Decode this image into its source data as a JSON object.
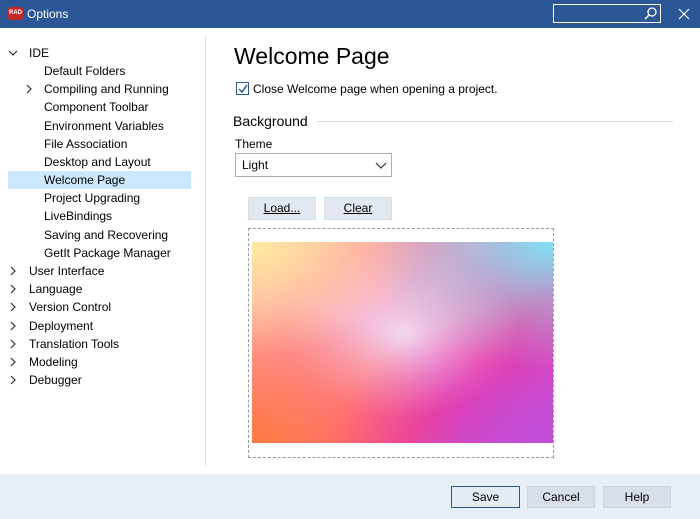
{
  "window": {
    "app_icon_text": "RAD",
    "title": "Options",
    "search_placeholder": ""
  },
  "tree": [
    {
      "label": "IDE",
      "expanded": true
    },
    {
      "label": "Default Folders"
    },
    {
      "label": "Compiling and Running",
      "expandable": true
    },
    {
      "label": "Component Toolbar"
    },
    {
      "label": "Environment Variables"
    },
    {
      "label": "File Association"
    },
    {
      "label": "Desktop and Layout"
    },
    {
      "label": "Welcome Page",
      "selected": true
    },
    {
      "label": "Project Upgrading"
    },
    {
      "label": "LiveBindings"
    },
    {
      "label": "Saving and Recovering"
    },
    {
      "label": "GetIt Package Manager"
    },
    {
      "label": "User Interface",
      "expandable": true
    },
    {
      "label": "Language",
      "expandable": true
    },
    {
      "label": "Version Control",
      "expandable": true
    },
    {
      "label": "Deployment",
      "expandable": true
    },
    {
      "label": "Translation Tools",
      "expandable": true
    },
    {
      "label": "Modeling",
      "expandable": true
    },
    {
      "label": "Debugger",
      "expandable": true
    }
  ],
  "page": {
    "heading": "Welcome Page",
    "close_checkbox_label": "Close Welcome page when opening a project.",
    "close_checkbox_checked": true,
    "section_label": "Background",
    "theme_label": "Theme",
    "theme_value": "Light",
    "load_label": "Load...",
    "clear_label": "Clear"
  },
  "footer": {
    "save_label": "Save",
    "cancel_label": "Cancel",
    "help_label": "Help"
  },
  "colors": {
    "titlebar": "#2b5797",
    "selection": "#cce8ff",
    "footer": "#e8eef5"
  }
}
